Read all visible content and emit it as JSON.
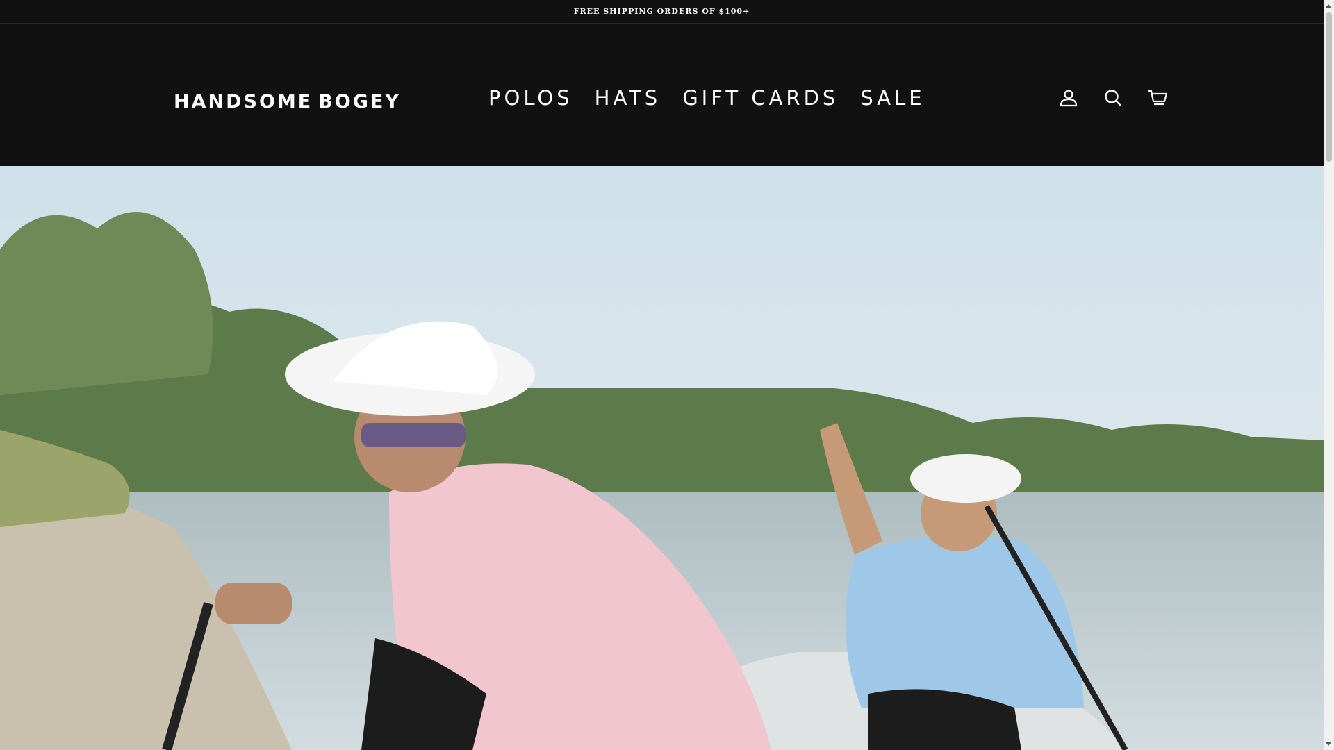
{
  "announcement": {
    "text": "FREE SHIPPING ORDERS OF $100+"
  },
  "logo": {
    "left_word": "HANDSOME",
    "right_word": "BOGEY"
  },
  "nav": {
    "items": [
      {
        "label": "POLOS"
      },
      {
        "label": "HATS"
      },
      {
        "label": "GIFT CARDS"
      },
      {
        "label": "SALE"
      }
    ]
  },
  "header_icons": [
    "account-icon",
    "search-icon",
    "cart-icon"
  ],
  "hero": {
    "description_icon": "hero-image"
  },
  "colors": {
    "background": "#111111",
    "text": "#ffffff"
  }
}
